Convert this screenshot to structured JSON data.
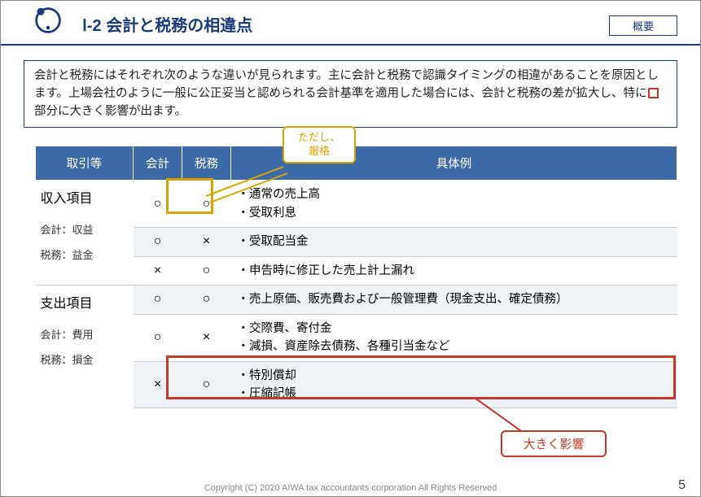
{
  "header": {
    "title": "Ⅰ-2  会計と税務の相違点",
    "tag": "概要"
  },
  "intro": {
    "line1": "会計と税務にはそれぞれ次のような違いが見られます。主に会計と税務で認識タイミングの相違があることを原因とします。上場会社のように一般に公正妥当と認められる会計基準を適用した場合には、会計と税務の差が拡大し、特に",
    "line2": "部分に大きく影響が出ます。"
  },
  "callouts": {
    "gold": "ただし、\n厳格",
    "red": "大きく影響"
  },
  "table": {
    "headers": {
      "c1": "取引等",
      "c2": "会計",
      "c3": "税務",
      "c4": "具体例"
    },
    "group1": {
      "title": "収入項目",
      "sub1": "会計：収益",
      "sub2": "税務：益金"
    },
    "group2": {
      "title": "支出項目",
      "sub1": "会計：費用",
      "sub2": "税務：損金"
    },
    "rows": [
      {
        "a": "○",
        "t": "○",
        "ex": "・通常の売上高\n・受取利息"
      },
      {
        "a": "○",
        "t": "×",
        "ex": "・受取配当金"
      },
      {
        "a": "×",
        "t": "○",
        "ex": "・申告時に修正した売上計上漏れ"
      },
      {
        "a": "○",
        "t": "○",
        "ex": "・売上原価、販売費および一般管理費（現金支出、確定債務）"
      },
      {
        "a": "○",
        "t": "×",
        "ex": "・交際費、寄付金\n・減損、資産除去債務、各種引当金など"
      },
      {
        "a": "×",
        "t": "○",
        "ex": "・特別償却\n・圧縮記帳"
      }
    ]
  },
  "footer": {
    "copyright": "Copyright (C) 2020 AIWA tax accountants corporation All Rights Reserved",
    "page": "5"
  }
}
